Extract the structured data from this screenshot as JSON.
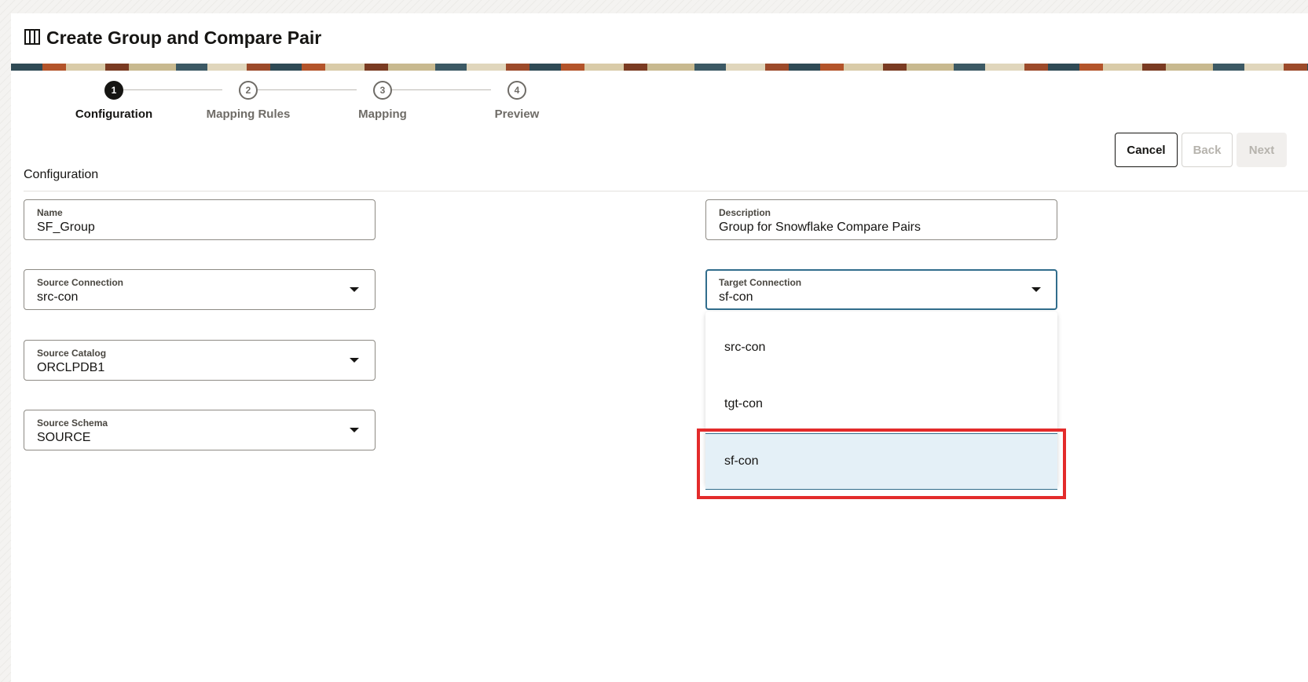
{
  "header": {
    "title": "Create Group and Compare Pair",
    "icon": "columns-icon"
  },
  "stepper": [
    {
      "number": "1",
      "label": "Configuration",
      "active": true
    },
    {
      "number": "2",
      "label": "Mapping Rules",
      "active": false
    },
    {
      "number": "3",
      "label": "Mapping",
      "active": false
    },
    {
      "number": "4",
      "label": "Preview",
      "active": false
    }
  ],
  "actions": {
    "cancel": "Cancel",
    "back": "Back",
    "next": "Next"
  },
  "section": {
    "title": "Configuration"
  },
  "fields": {
    "name": {
      "label": "Name",
      "value": "SF_Group"
    },
    "description": {
      "label": "Description",
      "value": "Group for Snowflake Compare Pairs"
    },
    "source_connection": {
      "label": "Source Connection",
      "value": "src-con"
    },
    "target_connection": {
      "label": "Target Connection",
      "value": "sf-con"
    },
    "source_catalog": {
      "label": "Source Catalog",
      "value": "ORCLPDB1"
    },
    "source_schema": {
      "label": "Source Schema",
      "value": "SOURCE"
    }
  },
  "target_dropdown": {
    "options": [
      "src-con",
      "tgt-con",
      "sf-con"
    ],
    "selected": "sf-con"
  },
  "colors": {
    "accent": "#316d8c",
    "highlight": "#e32b2b",
    "selected_bg": "#e4f0f7"
  }
}
